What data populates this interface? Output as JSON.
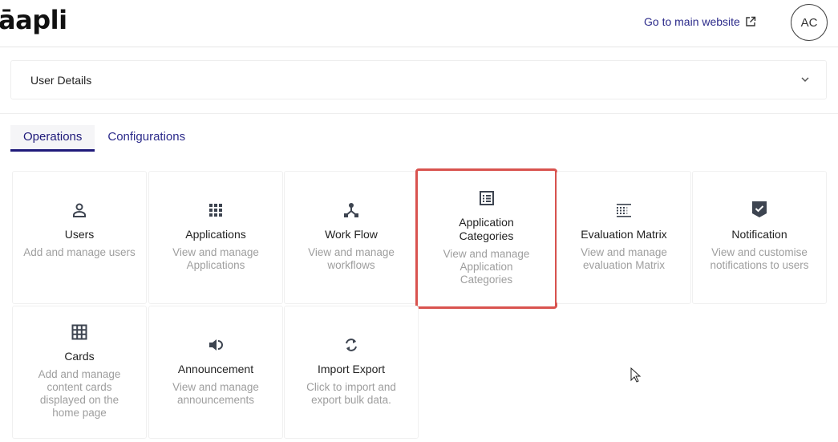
{
  "header": {
    "logo": "āapli",
    "main_link": "Go to main website",
    "avatar_initials": "AC"
  },
  "accordion": {
    "title": "User Details"
  },
  "tabs": [
    {
      "label": "Operations",
      "active": true
    },
    {
      "label": "Configurations",
      "active": false
    }
  ],
  "cards": [
    {
      "icon": "user-icon",
      "title": "Users",
      "desc": "Add and manage users"
    },
    {
      "icon": "grid-dots-icon",
      "title": "Applications",
      "desc": "View and manage Applications"
    },
    {
      "icon": "workflow-icon",
      "title": "Work Flow",
      "desc": "View and manage workflows"
    },
    {
      "icon": "list-icon",
      "title": "Application Categories",
      "desc": "View and manage Application Categories",
      "selected": true
    },
    {
      "icon": "matrix-icon",
      "title": "Evaluation Matrix",
      "desc": "View and manage evaluation Matrix"
    },
    {
      "icon": "shield-check-icon",
      "title": "Notification",
      "desc": "View and customise notifications to users"
    },
    {
      "icon": "table-icon",
      "title": "Cards",
      "desc": "Add and manage content cards displayed on the home page"
    },
    {
      "icon": "speaker-icon",
      "title": "Announcement",
      "desc": "View and manage announcements"
    },
    {
      "icon": "sync-icon",
      "title": "Import Export",
      "desc": "Click to import and export bulk data."
    }
  ],
  "colors": {
    "accent": "#1f1a7a",
    "link": "#2b2a8a",
    "highlight": "#d9534f",
    "icon": "#3d4450"
  }
}
